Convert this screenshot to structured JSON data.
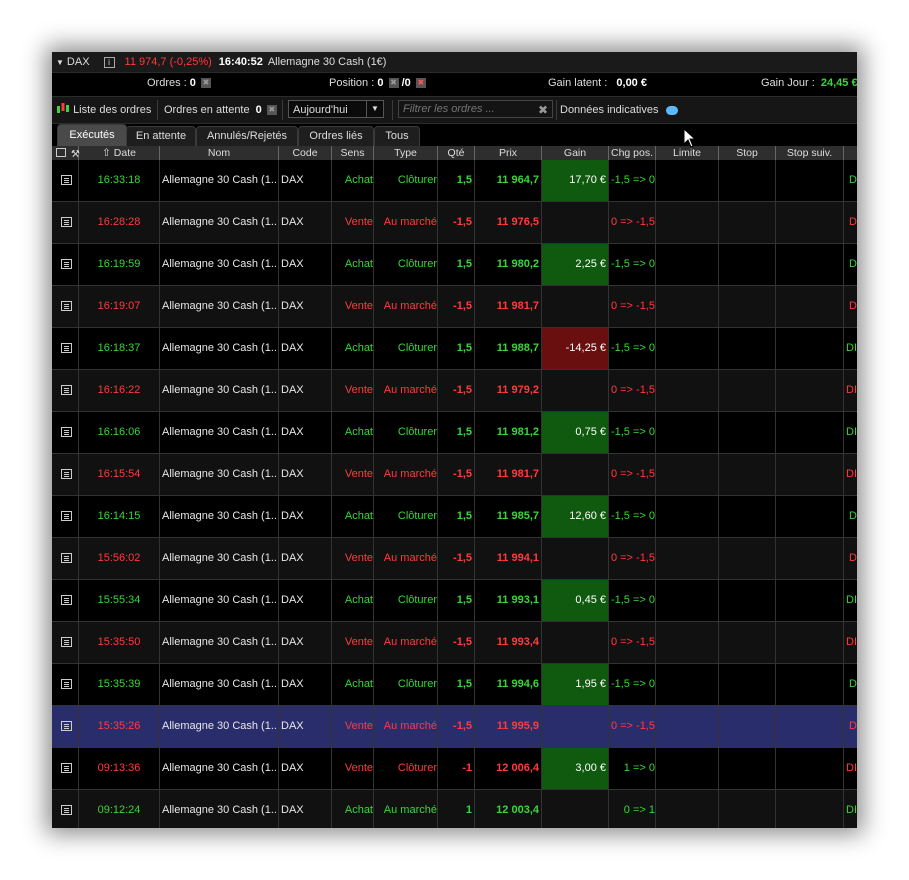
{
  "titlebar": {
    "instrument": "DAX",
    "quote": "11 974,7 (-0,25%)",
    "time": "16:40:52",
    "name": "Allemagne 30 Cash (1€)"
  },
  "status": {
    "orders_label": "Ordres :",
    "orders_value": "0",
    "position_label": "Position :",
    "position_value": "0",
    "position_total": "/0",
    "gain_latent_label": "Gain latent :",
    "gain_latent_value": "0,00 €",
    "gain_jour_label": "Gain Jour :",
    "gain_jour_value": "24,45 €"
  },
  "toolbar": {
    "orders_list": "Liste des ordres",
    "pending_label": "Ordres en attente",
    "pending_count": "0",
    "period": "Aujourd'hui",
    "filter_placeholder": "Filtrer les ordres ...",
    "indicative": "Données indicatives"
  },
  "tabs": [
    "Exécutés",
    "En attente",
    "Annulés/Rejetés",
    "Ordres liés",
    "Tous"
  ],
  "columns": [
    "Date",
    "Nom",
    "Code",
    "Sens",
    "Type",
    "Qté",
    "Prix",
    "Gain",
    "Chg pos.",
    "Limite",
    "Stop",
    "Stop suiv."
  ],
  "rows": [
    {
      "date": "16:33:18",
      "nom": "Allemagne 30 Cash (1...",
      "code": "DAX",
      "sens": "Achat",
      "type": "Clôturer",
      "qte": "1,5",
      "prix": "11 964,7",
      "gain": "17,70 €",
      "chg": "-1,5 => 0",
      "last": "D"
    },
    {
      "date": "16:28:28",
      "nom": "Allemagne 30 Cash (1...",
      "code": "DAX",
      "sens": "Vente",
      "type": "Au marché",
      "qte": "-1,5",
      "prix": "11 976,5",
      "gain": "",
      "chg": "0 => -1,5",
      "last": "D"
    },
    {
      "date": "16:19:59",
      "nom": "Allemagne 30 Cash (1...",
      "code": "DAX",
      "sens": "Achat",
      "type": "Clôturer",
      "qte": "1,5",
      "prix": "11 980,2",
      "gain": "2,25 €",
      "chg": "-1,5 => 0",
      "last": "D"
    },
    {
      "date": "16:19:07",
      "nom": "Allemagne 30 Cash (1...",
      "code": "DAX",
      "sens": "Vente",
      "type": "Au marché",
      "qte": "-1,5",
      "prix": "11 981,7",
      "gain": "",
      "chg": "0 => -1,5",
      "last": "D"
    },
    {
      "date": "16:18:37",
      "nom": "Allemagne 30 Cash (1...",
      "code": "DAX",
      "sens": "Achat",
      "type": "Clôturer",
      "qte": "1,5",
      "prix": "11 988,7",
      "gain": "-14,25 €",
      "chg": "-1,5 => 0",
      "last": "DI"
    },
    {
      "date": "16:16:22",
      "nom": "Allemagne 30 Cash (1...",
      "code": "DAX",
      "sens": "Vente",
      "type": "Au marché",
      "qte": "-1,5",
      "prix": "11 979,2",
      "gain": "",
      "chg": "0 => -1,5",
      "last": "DI"
    },
    {
      "date": "16:16:06",
      "nom": "Allemagne 30 Cash (1...",
      "code": "DAX",
      "sens": "Achat",
      "type": "Clôturer",
      "qte": "1,5",
      "prix": "11 981,2",
      "gain": "0,75 €",
      "chg": "-1,5 => 0",
      "last": "DI"
    },
    {
      "date": "16:15:54",
      "nom": "Allemagne 30 Cash (1...",
      "code": "DAX",
      "sens": "Vente",
      "type": "Au marché",
      "qte": "-1,5",
      "prix": "11 981,7",
      "gain": "",
      "chg": "0 => -1,5",
      "last": "DI"
    },
    {
      "date": "16:14:15",
      "nom": "Allemagne 30 Cash (1...",
      "code": "DAX",
      "sens": "Achat",
      "type": "Clôturer",
      "qte": "1,5",
      "prix": "11 985,7",
      "gain": "12,60 €",
      "chg": "-1,5 => 0",
      "last": "D"
    },
    {
      "date": "15:56:02",
      "nom": "Allemagne 30 Cash (1...",
      "code": "DAX",
      "sens": "Vente",
      "type": "Au marché",
      "qte": "-1,5",
      "prix": "11 994,1",
      "gain": "",
      "chg": "0 => -1,5",
      "last": "D"
    },
    {
      "date": "15:55:34",
      "nom": "Allemagne 30 Cash (1...",
      "code": "DAX",
      "sens": "Achat",
      "type": "Clôturer",
      "qte": "1,5",
      "prix": "11 993,1",
      "gain": "0,45 €",
      "chg": "-1,5 => 0",
      "last": "DI"
    },
    {
      "date": "15:35:50",
      "nom": "Allemagne 30 Cash (1...",
      "code": "DAX",
      "sens": "Vente",
      "type": "Au marché",
      "qte": "-1,5",
      "prix": "11 993,4",
      "gain": "",
      "chg": "0 => -1,5",
      "last": "DI"
    },
    {
      "date": "15:35:39",
      "nom": "Allemagne 30 Cash (1...",
      "code": "DAX",
      "sens": "Achat",
      "type": "Clôturer",
      "qte": "1,5",
      "prix": "11 994,6",
      "gain": "1,95 €",
      "chg": "-1,5 => 0",
      "last": "D"
    },
    {
      "date": "15:35:26",
      "nom": "Allemagne 30 Cash (1...",
      "code": "DAX",
      "sens": "Vente",
      "type": "Au marché",
      "qte": "-1,5",
      "prix": "11 995,9",
      "gain": "",
      "chg": "0 => -1,5",
      "last": "D"
    },
    {
      "date": "09:13:36",
      "nom": "Allemagne 30 Cash (1...",
      "code": "DAX",
      "sens": "Vente",
      "type": "Clôturer",
      "qte": "-1",
      "prix": "12 006,4",
      "gain": "3,00 €",
      "chg": "1 => 0",
      "last": "DI"
    },
    {
      "date": "09:12:24",
      "nom": "Allemagne 30 Cash (1...",
      "code": "DAX",
      "sens": "Achat",
      "type": "Au marché",
      "qte": "1",
      "prix": "12 003,4",
      "gain": "",
      "chg": "0 => 1",
      "last": "DI"
    }
  ],
  "selected_row": 13,
  "colors": {
    "buy": "#39d639",
    "sell": "#ff3b3b",
    "gain_positive_bg": "#0f5a0f",
    "gain_negative_bg": "#6a0f0f",
    "selected_row_bg": "#2a2d6b"
  }
}
